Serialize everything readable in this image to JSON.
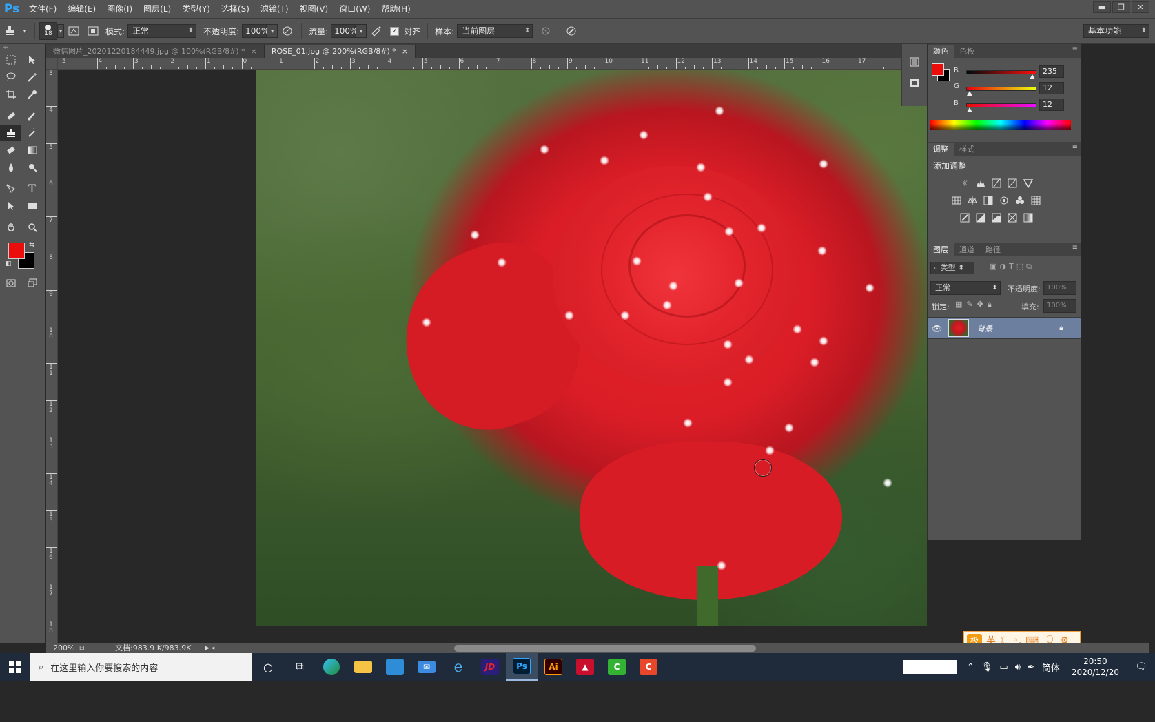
{
  "app": {
    "logo": "Ps"
  },
  "menu": [
    "文件(F)",
    "编辑(E)",
    "图像(I)",
    "图层(L)",
    "类型(Y)",
    "选择(S)",
    "滤镜(T)",
    "视图(V)",
    "窗口(W)",
    "帮助(H)"
  ],
  "window_controls": {
    "minimize": "▬",
    "restore": "❐",
    "close": "✕"
  },
  "options": {
    "brush_size": "18",
    "mode_label": "模式:",
    "mode_value": "正常",
    "opacity_label": "不透明度:",
    "opacity_value": "100%",
    "flow_label": "流量:",
    "flow_value": "100%",
    "align_label": "对齐",
    "align_checked": true,
    "sample_label": "样本:",
    "sample_value": "当前图层",
    "workspace": "基本功能"
  },
  "tabs": [
    {
      "label": "微信图片_20201220184449.jpg @ 100%(RGB/8#) *",
      "close": "×",
      "active": false
    },
    {
      "label": "ROSE_01.jpg @ 200%(RGB/8#) *",
      "close": "×",
      "active": true
    }
  ],
  "ruler_h": [
    "5",
    "4",
    "3",
    "2",
    "1",
    "0",
    "1",
    "2",
    "3",
    "4",
    "5",
    "6",
    "7",
    "8",
    "9",
    "10",
    "11",
    "12",
    "13",
    "14",
    "15",
    "16",
    "17"
  ],
  "ruler_v": [
    "3",
    "4",
    "5",
    "6",
    "7",
    "8",
    "9",
    "10",
    "11",
    "12",
    "13",
    "14",
    "15",
    "16",
    "17",
    "18"
  ],
  "colors": {
    "foreground": "#eb0c0c",
    "background": "#000000",
    "accent": "#31a8ff",
    "layer_selected": "#6c7f9e"
  },
  "color_panel": {
    "tabs": [
      "颜色",
      "色板"
    ],
    "r_label": "R",
    "r_value": "235",
    "g_label": "G",
    "g_value": "12",
    "b_label": "B",
    "b_value": "12"
  },
  "adjust_panel": {
    "tabs": [
      "调整",
      "样式"
    ],
    "title": "添加调整"
  },
  "layers_panel": {
    "tabs": [
      "图层",
      "通道",
      "路径"
    ],
    "filter": "类型",
    "blend_mode": "正常",
    "opacity_label": "不透明度:",
    "opacity_value": "100%",
    "lock_label": "锁定:",
    "fill_label": "填充:",
    "fill_value": "100%",
    "layer_name": "背景"
  },
  "status": {
    "zoom": "200%",
    "doc_info": "文档:983.9 K/983.9K"
  },
  "ime": {
    "logo": "极",
    "lang": "英"
  },
  "taskbar": {
    "search_placeholder": "在这里输入你要搜索的内容",
    "apps": [
      "cortana",
      "task-view",
      "edge",
      "file-explorer",
      "store",
      "mail",
      "ie",
      "jd",
      "photoshop",
      "illustrator",
      "autocad",
      "camtasia",
      "app-c"
    ],
    "app_labels": {
      "jd": "JD",
      "ps": "Ps",
      "ai": "Ai"
    },
    "input_method": "简体",
    "time": "20:50",
    "date": "2020/12/20"
  }
}
